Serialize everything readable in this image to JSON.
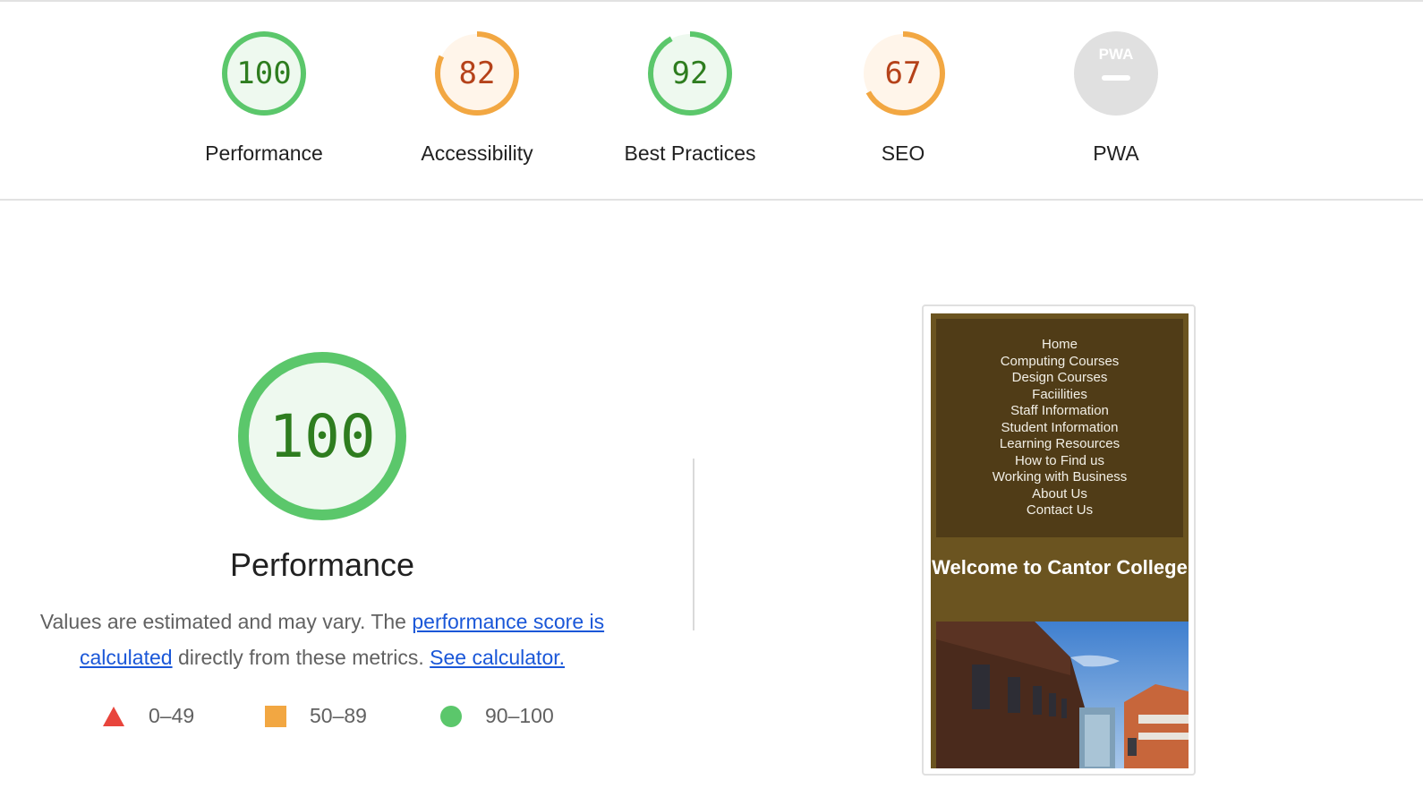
{
  "categories": [
    {
      "id": "performance",
      "score": "100",
      "label": "Performance",
      "level": "pass",
      "fraction": 1.0
    },
    {
      "id": "accessibility",
      "score": "82",
      "label": "Accessibility",
      "level": "average",
      "fraction": 0.82
    },
    {
      "id": "best-practices",
      "score": "92",
      "label": "Best Practices",
      "level": "pass",
      "fraction": 0.92
    },
    {
      "id": "seo",
      "score": "67",
      "label": "SEO",
      "level": "average",
      "fraction": 0.67
    },
    {
      "id": "pwa",
      "score": "",
      "badge": "PWA",
      "label": "PWA",
      "level": "na",
      "fraction": 0
    }
  ],
  "performance_section": {
    "score": "100",
    "title": "Performance",
    "desc_prefix": "Values are estimated and may vary. The ",
    "link_score": "performance score is calculated",
    "desc_middle": " directly from these metrics. ",
    "link_calculator": "See calculator."
  },
  "legend": [
    {
      "shape": "triangle",
      "range": "0–49",
      "color": "#e8453c"
    },
    {
      "shape": "square",
      "range": "50–89",
      "color": "#f2a742"
    },
    {
      "shape": "circle",
      "range": "90–100",
      "color": "#5bc76b"
    }
  ],
  "colors": {
    "pass": "#5bc76b",
    "pass_text": "#2e7d1f",
    "pass_fill": "#eef9ef",
    "average": "#f2a742",
    "average_text": "#b5421a",
    "average_fill": "#fff5ea",
    "na": "#e0e0e0"
  },
  "screenshot": {
    "nav": [
      "Home",
      "Computing Courses",
      "Design Courses",
      "Faciilities",
      "Staff Information",
      "Student Information",
      "Learning Resources",
      "How to Find us",
      "Working with Business",
      "About Us",
      "Contact Us"
    ],
    "heading": "Welcome to Cantor College"
  }
}
